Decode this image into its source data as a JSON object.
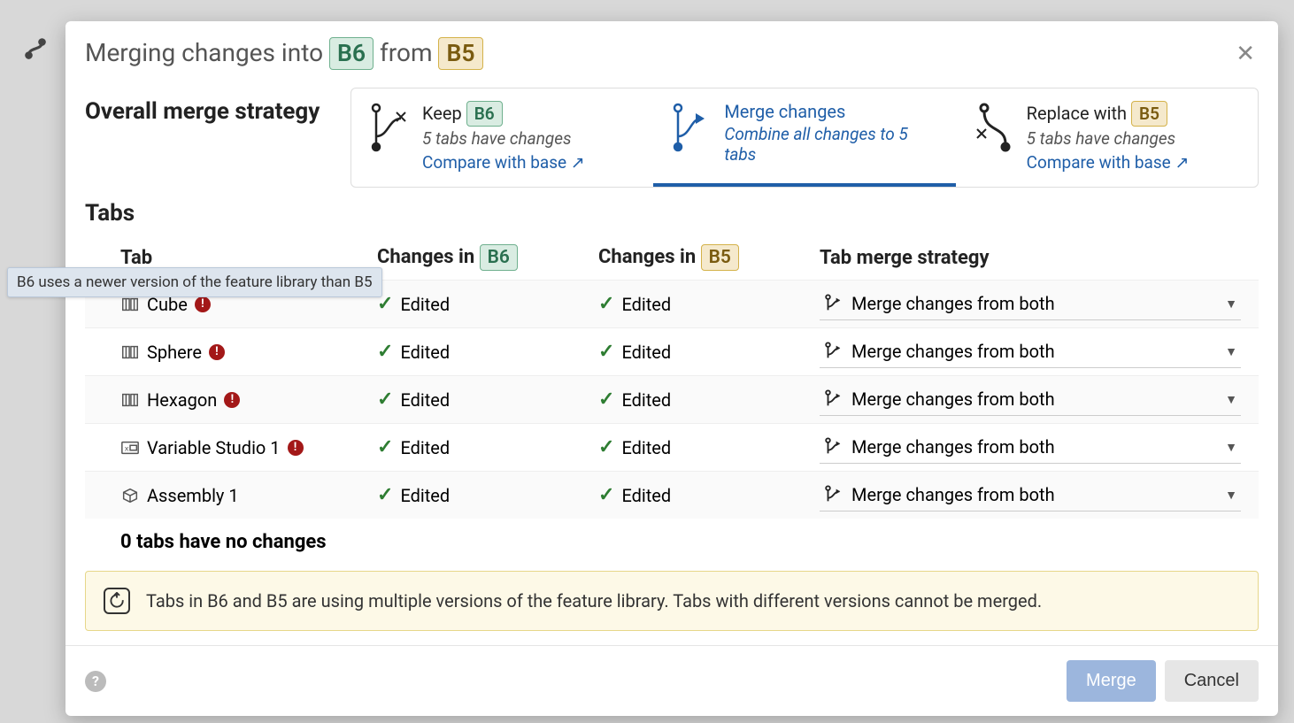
{
  "dialog": {
    "title_prefix": "Merging changes into",
    "title_middle": "from",
    "target_branch": "B6",
    "source_branch": "B5"
  },
  "strategy": {
    "label": "Overall merge strategy",
    "cards": [
      {
        "title_prefix": "Keep",
        "badge": "B6",
        "sub": "5 tabs have changes",
        "link": "Compare with base ↗"
      },
      {
        "title": "Merge changes",
        "sub": "Combine all changes to 5 tabs"
      },
      {
        "title_prefix": "Replace with",
        "badge": "B5",
        "sub": "5 tabs have changes",
        "link": "Compare with base ↗"
      }
    ]
  },
  "tabs": {
    "title": "Tabs",
    "columns": {
      "tab": "Tab",
      "b6_prefix": "Changes in",
      "b6_badge": "B6",
      "b5_prefix": "Changes in",
      "b5_badge": "B5",
      "strategy": "Tab merge strategy"
    },
    "rows": [
      {
        "name": "Cube",
        "icon": "partstudio",
        "warn": true,
        "b6": "Edited",
        "b5": "Edited",
        "strategy": "Merge changes from both"
      },
      {
        "name": "Sphere",
        "icon": "partstudio",
        "warn": true,
        "b6": "Edited",
        "b5": "Edited",
        "strategy": "Merge changes from both"
      },
      {
        "name": "Hexagon",
        "icon": "partstudio",
        "warn": true,
        "b6": "Edited",
        "b5": "Edited",
        "strategy": "Merge changes from both"
      },
      {
        "name": "Variable Studio 1",
        "icon": "variable",
        "warn": true,
        "b6": "Edited",
        "b5": "Edited",
        "strategy": "Merge changes from both"
      },
      {
        "name": "Assembly 1",
        "icon": "assembly",
        "warn": false,
        "b6": "Edited",
        "b5": "Edited",
        "strategy": "Merge changes from both"
      }
    ],
    "no_changes": "0 tabs have no changes"
  },
  "banner": {
    "text": "Tabs in B6 and B5 are using multiple versions of the feature library. Tabs with different versions cannot be merged."
  },
  "footer": {
    "merge": "Merge",
    "cancel": "Cancel"
  },
  "tooltip": {
    "text": "B6 uses a newer version of the feature library than B5"
  }
}
